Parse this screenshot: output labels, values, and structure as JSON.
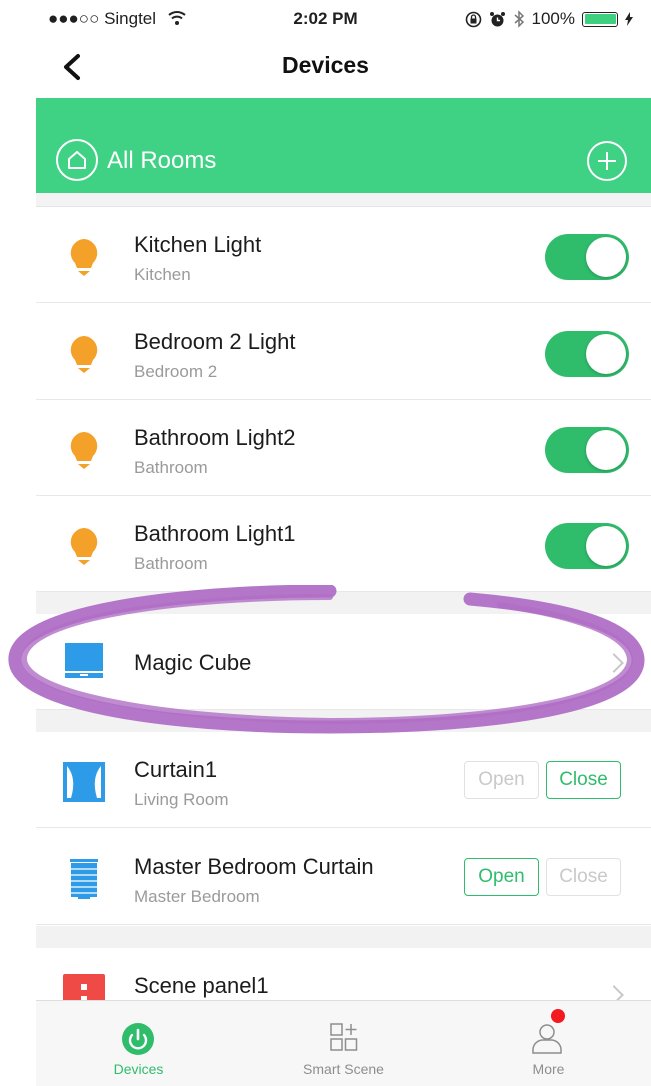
{
  "status_bar": {
    "carrier": "●●●○○ Singtel",
    "time": "2:02 PM",
    "battery": "100%",
    "icons": [
      "wifi-icon",
      "lock-rotation-icon",
      "alarm-icon",
      "bluetooth-icon",
      "battery-icon",
      "charging-icon"
    ]
  },
  "nav": {
    "title": "Devices"
  },
  "rooms_header": {
    "label": "All Rooms",
    "color": "#3fd184"
  },
  "devices": [
    {
      "name": "Kitchen Light",
      "room": "Kitchen",
      "icon": "bulb-icon",
      "on": true
    },
    {
      "name": "Bedroom 2 Light",
      "room": "Bedroom 2",
      "icon": "bulb-icon",
      "on": true
    },
    {
      "name": "Bathroom Light2",
      "room": "Bathroom",
      "icon": "bulb-icon",
      "on": true
    },
    {
      "name": "Bathroom Light1",
      "room": "Bathroom",
      "icon": "bulb-icon",
      "on": true
    }
  ],
  "magic_cube": {
    "name": "Magic Cube",
    "icon": "magic-cube-icon"
  },
  "curtains": [
    {
      "name": "Curtain1",
      "room": "Living Room",
      "icon": "curtain-icon",
      "open_label": "Open",
      "close_label": "Close",
      "active": "close"
    },
    {
      "name": "Master Bedroom Curtain",
      "room": "Master Bedroom",
      "icon": "blind-icon",
      "open_label": "Open",
      "close_label": "Close",
      "active": "open"
    }
  ],
  "scene_panel": {
    "name": "Scene panel1",
    "icon": "scene-panel-icon"
  },
  "tabs": [
    {
      "label": "Devices",
      "icon": "power-icon",
      "active": true
    },
    {
      "label": "Smart Scene",
      "icon": "smart-scene-icon",
      "active": false
    },
    {
      "label": "More",
      "icon": "person-icon",
      "active": false,
      "badge": true
    }
  ],
  "colors": {
    "accent": "#2fbd6c",
    "bulb": "#f4a12a",
    "annotation": "#b06fc6",
    "badge": "#f2191f"
  }
}
